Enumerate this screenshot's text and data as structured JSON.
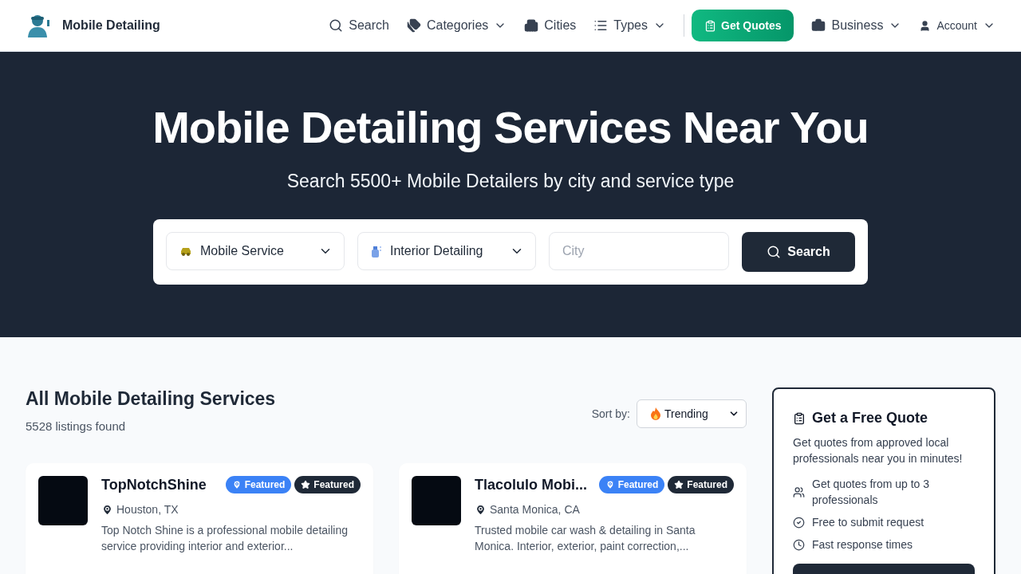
{
  "brand": {
    "name": "Mobile Detailing"
  },
  "nav": [
    {
      "label": "Search",
      "kind": "link",
      "has_caret": false
    },
    {
      "label": "Categories",
      "kind": "link",
      "has_caret": true
    },
    {
      "label": "Cities",
      "kind": "link",
      "has_caret": false
    },
    {
      "label": "Types",
      "kind": "link",
      "has_caret": true
    },
    {
      "label": "Get Quotes",
      "kind": "primary",
      "has_caret": false
    },
    {
      "label": "Business",
      "kind": "link",
      "has_caret": true
    },
    {
      "label": "Account",
      "kind": "small",
      "has_caret": true
    }
  ],
  "hero": {
    "title": "Mobile Detailing Services Near You",
    "subtitle": "Search 5500+ Mobile Detailers by city and service type",
    "service_select": "Mobile Service",
    "type_select": "Interior Detailing",
    "city_placeholder": "City",
    "search_button": "Search"
  },
  "listing": {
    "heading": "All Mobile Detailing Services",
    "count": "5528 listings found",
    "sort_label": "Sort by:",
    "sort_value": "Trending"
  },
  "cards": [
    {
      "name": "TopNotchShine",
      "badges": [
        {
          "label": "Featured",
          "kind": "location"
        },
        {
          "label": "Featured",
          "kind": "star"
        }
      ],
      "location": "Houston, TX",
      "description": "Top Notch Shine is a professional mobile detailing service providing interior and exterior..."
    },
    {
      "name": "Tlacolulo Mobi...",
      "badges": [
        {
          "label": "Featured",
          "kind": "location"
        },
        {
          "label": "Featured",
          "kind": "star"
        }
      ],
      "location": "Santa Monica, CA",
      "description": "Trusted mobile car wash & detailing in Santa Monica. Interior, exterior, paint correction,..."
    }
  ],
  "quote_panel": {
    "title": "Get a Free Quote",
    "text": "Get quotes from approved local professionals near you in minutes!",
    "points": [
      {
        "text": "Get quotes from up to 3 professionals",
        "kind": "users"
      },
      {
        "text": "Free to submit request",
        "kind": "check"
      },
      {
        "text": "Fast response times",
        "kind": "clock"
      }
    ]
  }
}
